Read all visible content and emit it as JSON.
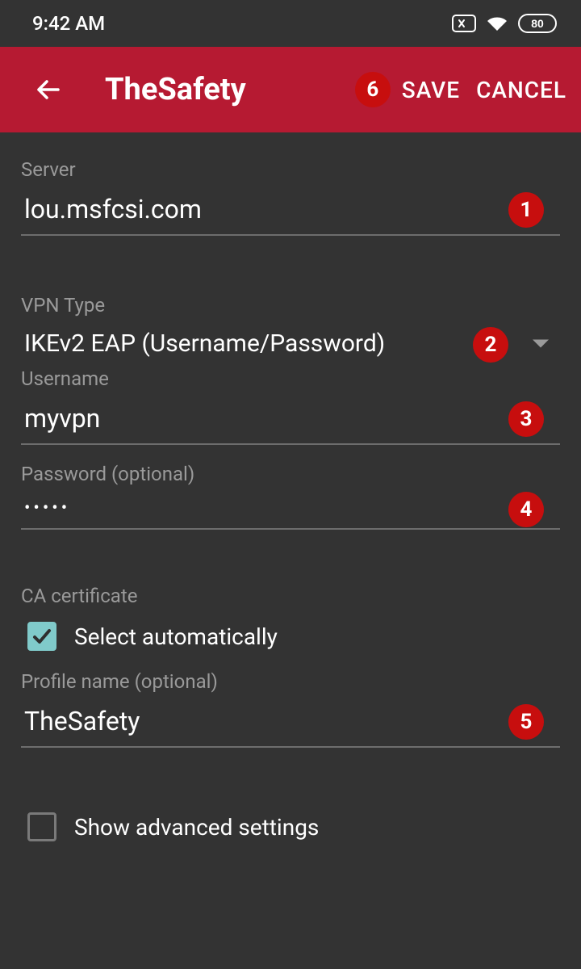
{
  "status": {
    "time": "9:42 AM",
    "battery": "80"
  },
  "appbar": {
    "title": "TheSafety",
    "save": "SAVE",
    "cancel": "CANCEL",
    "badge6": "6"
  },
  "fields": {
    "server_label": "Server",
    "server_value": "lou.msfcsi.com",
    "badge1": "1",
    "vpn_type_label": "VPN Type",
    "vpn_type_value": "IKEv2 EAP (Username/Password)",
    "badge2": "2",
    "username_label": "Username",
    "username_value": "myvpn",
    "badge3": "3",
    "password_label": "Password (optional)",
    "password_value": "•••••",
    "badge4": "4",
    "ca_label": "CA certificate",
    "ca_select_auto": "Select automatically",
    "profile_label": "Profile name (optional)",
    "profile_value": "TheSafety",
    "badge5": "5",
    "advanced": "Show advanced settings"
  }
}
